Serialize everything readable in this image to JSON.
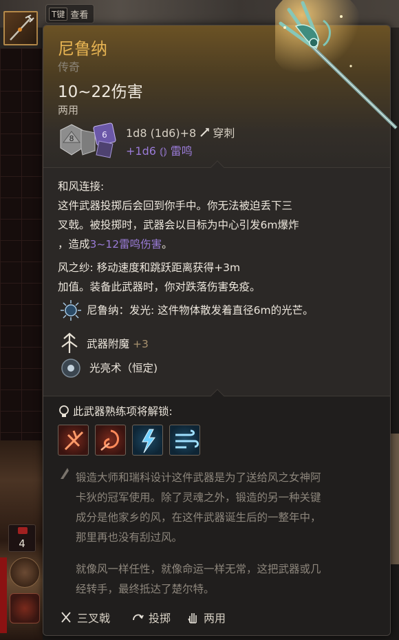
{
  "key_hint": {
    "key": "T键",
    "label": "查看"
  },
  "item": {
    "name": "尼鲁纳",
    "rarity": "传奇",
    "damage": "10~22伤害",
    "handedness": "两用",
    "dice_primary": "1d8 (1d6)+8",
    "damage_type": "穿刺",
    "dice_bonus": "+1d6",
    "bonus_type": "雷鸣",
    "dice_face_primary": "8",
    "dice_face_bonus": "6"
  },
  "description": {
    "ability1_title": "和风连接:",
    "ability1_line1": "这件武器投掷后会回到你手中。你无法被迫丢下三",
    "ability1_line2": "叉戟。被投掷时，武器会以目标为中心引发6m爆炸",
    "ability1_line3_pre": "，造成",
    "ability1_line3_damage": "3~12雷鸣伤害",
    "ability1_line3_post": "。",
    "ability2_line1": "风之纱: 移动速度和跳跃距离获得+3m",
    "ability2_line2": "加值。装备此武器时，你对跌落伤害免疫。",
    "glow_text": "尼鲁纳：发光: 这件物体散发着直径6m的光芒。",
    "enchant_label": "武器附魔",
    "enchant_value": "+3",
    "spell_label": "光亮术（恒定)"
  },
  "proficiency": {
    "title": "此武器熟练项将解锁:",
    "icons": [
      "slash-skill-icon",
      "whirl-skill-icon",
      "lightning-skill-icon",
      "wind-skill-icon"
    ]
  },
  "lore": {
    "para1_line1": "锻造大师和瑞科设计这件武器是为了送给风之女神阿",
    "para1_line2": "卡狄的冠军使用。除了灵魂之外，锻造的另一种关键",
    "para1_line3": "成分是他家乡的风，在这件武器诞生后的一整年中，",
    "para1_line4": "那里再也没有刮过风。",
    "para2_line1": "就像风一样任性，就像命运一样无常，这把武器或几",
    "para2_line2": "经转手，最终抵达了楚尔特。"
  },
  "footer": {
    "weapon_type": "三叉戟",
    "throw": "投掷",
    "versatile": "两用"
  },
  "hud": {
    "stack_count": "4"
  },
  "colors": {
    "name_gold": "#e6b352",
    "thunder_purple": "#9a7bd7",
    "panel": "#2b2826"
  }
}
